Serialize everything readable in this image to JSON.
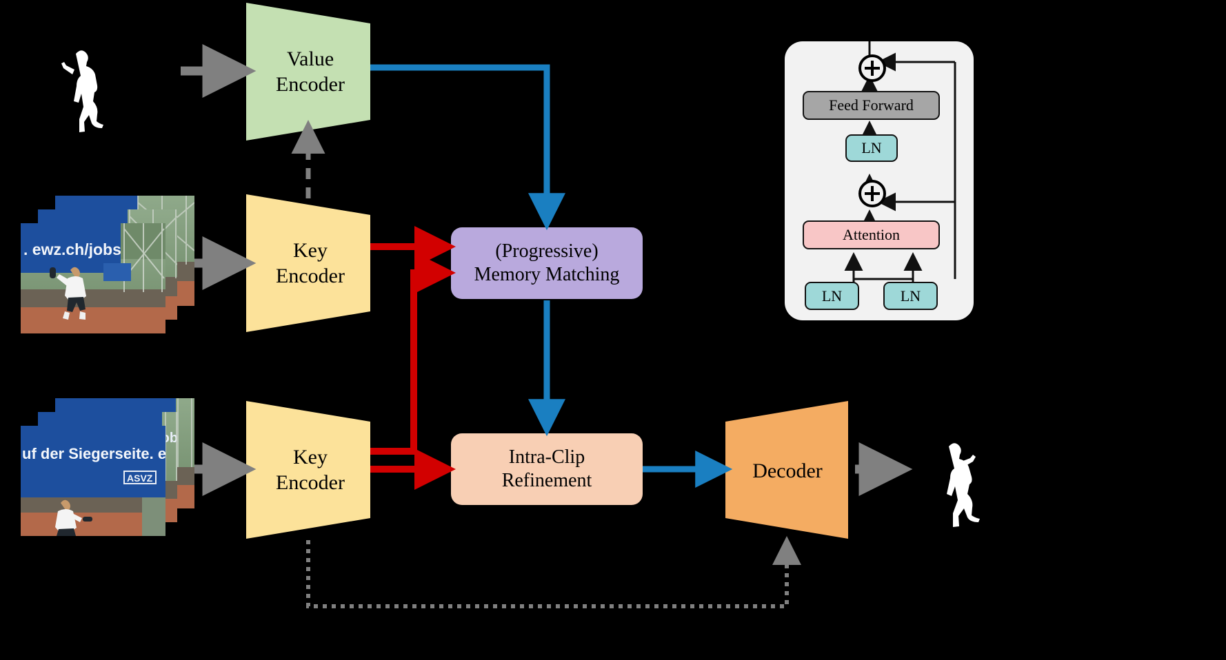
{
  "figure": {
    "type": "architecture-diagram",
    "domain": "video-object-segmentation",
    "background_color": "#000000"
  },
  "nodes": {
    "value_encoder": {
      "label_line1": "Value",
      "label_line2": "Encoder",
      "color": "#c4e0b2",
      "shape": "trapezoid"
    },
    "key_encoder_top": {
      "label_line1": "Key",
      "label_line2": "Encoder",
      "color": "#fce29a",
      "shape": "trapezoid"
    },
    "key_encoder_bot": {
      "label_line1": "Key",
      "label_line2": "Encoder",
      "color": "#fce29a",
      "shape": "trapezoid"
    },
    "memory_matching": {
      "label_line1": "(Progressive)",
      "label_line2": "Memory Matching",
      "color": "#b9a9dd",
      "shape": "rounded-rect"
    },
    "intra_clip": {
      "label_line1": "Intra-Clip",
      "label_line2": "Refinement",
      "color": "#f8cfb4",
      "shape": "rounded-rect"
    },
    "decoder": {
      "label_line1": "Decoder",
      "label_line2": "",
      "color": "#f4ac62",
      "shape": "trapezoid-reverse"
    }
  },
  "transformer_block": {
    "panel_color": "#f2f2f2",
    "items": [
      {
        "name": "feed-forward",
        "label": "Feed Forward",
        "color": "#a6a6a6"
      },
      {
        "name": "ln-upper",
        "label": "LN",
        "color": "#9ed8d8"
      },
      {
        "name": "attention",
        "label": "Attention",
        "color": "#f8c6c6"
      },
      {
        "name": "ln-left",
        "label": "LN",
        "color": "#9ed8d8"
      },
      {
        "name": "ln-right",
        "label": "LN",
        "color": "#9ed8d8"
      }
    ],
    "residual_nodes": [
      {
        "name": "add-upper",
        "symbol": "+"
      },
      {
        "name": "add-lower",
        "symbol": "+"
      }
    ]
  },
  "edges": {
    "gray_solid": {
      "color": "#808080",
      "style": "solid",
      "meaning": "input"
    },
    "gray_dashed": {
      "color": "#808080",
      "style": "dashed",
      "meaning": "mask-feedback"
    },
    "blue": {
      "color": "#1a7fc1",
      "style": "solid",
      "meaning": "feature-flow"
    },
    "red": {
      "color": "#d20000",
      "style": "solid",
      "meaning": "key-flow"
    }
  },
  "inputs": {
    "mask_top": {
      "name": "reference-mask",
      "alt": "white tennis player silhouette mask"
    },
    "frames_mid": {
      "name": "memory-frames",
      "alt": "stack of 3 tennis court frames",
      "banner_text": ". ewz.ch/jobs"
    },
    "frames_bot": {
      "name": "query-frames",
      "alt": "stack of 3 tennis court frames",
      "banner_text": "uf der Siegerseite. ewz.ch/jobs",
      "sign_text": "ASVZ"
    }
  },
  "outputs": {
    "mask_out": {
      "name": "predicted-mask",
      "alt": "white tennis player silhouette mask"
    }
  }
}
